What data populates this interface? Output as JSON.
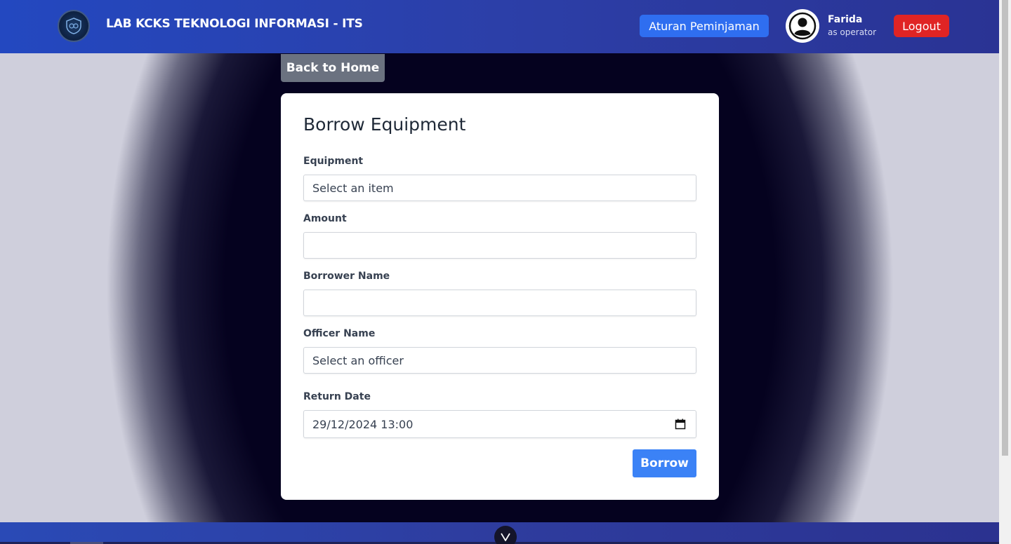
{
  "header": {
    "title": "LAB KCKS TEKNOLOGI INFORMASI - ITS",
    "rules_label": "Aturan Peminjaman",
    "user_name": "Farida",
    "user_role": "as operator",
    "logout_label": "Logout"
  },
  "back_label": "Back to Home",
  "form": {
    "title": "Borrow Equipment",
    "equipment_label": "Equipment",
    "equipment_value": "Select an item",
    "amount_label": "Amount",
    "amount_value": "",
    "borrower_label": "Borrower Name",
    "borrower_value": "",
    "officer_label": "Officer Name",
    "officer_value": "Select an officer",
    "return_label": "Return Date",
    "return_value": "29/12/2024 13:00",
    "submit_label": "Borrow"
  },
  "icons": {
    "logo": "lab-shield-logo",
    "avatar": "user-circle-icon",
    "calendar": "calendar-icon",
    "scroll": "chevron-down-icon"
  },
  "colors": {
    "primary": "#3b82f6",
    "danger": "#e02424",
    "header": "#2c3fa8"
  }
}
